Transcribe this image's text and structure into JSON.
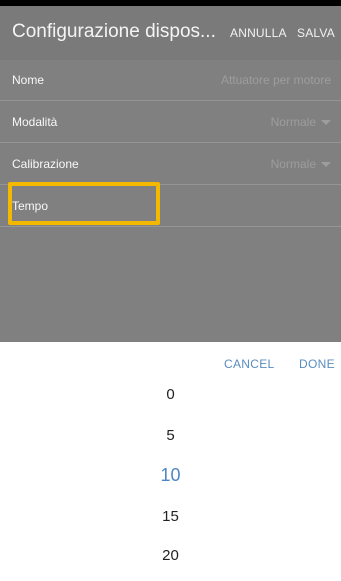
{
  "header": {
    "title": "Configurazione dispos...",
    "cancel_label": "ANNULLA",
    "save_label": "SALVA"
  },
  "form": {
    "rows": [
      {
        "label": "Nome",
        "value": "Attuatore per motore"
      },
      {
        "label": "Modalità",
        "value": "Normale"
      },
      {
        "label": "Calibrazione",
        "value": "Normale"
      },
      {
        "label": "Tempo",
        "value": ""
      }
    ]
  },
  "picker": {
    "cancel_label": "CANCEL",
    "done_label": "DONE",
    "options": [
      "0",
      "5",
      "10",
      "15",
      "20"
    ],
    "selected": "10"
  },
  "colors": {
    "highlight": "#f5b800",
    "accent": "#4f86c6"
  }
}
